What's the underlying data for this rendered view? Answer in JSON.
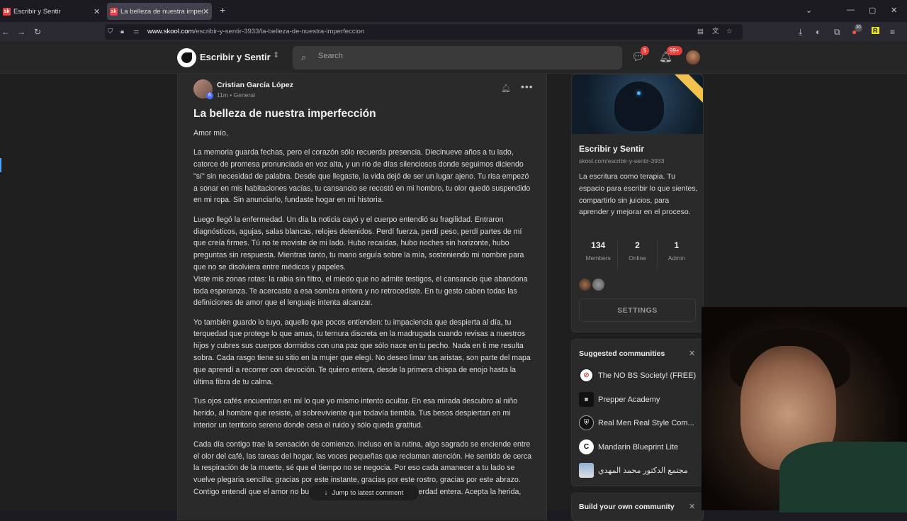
{
  "browser": {
    "tabs": [
      {
        "favicon": "sk",
        "label": "Escribir y Sentir",
        "active": false
      },
      {
        "favicon": "sk",
        "label": "La belleza de nuestra imperfecc",
        "active": true
      }
    ],
    "url_host": "www.skool.com",
    "url_path": "/escribir-y-sentir-3933/la-belleza-de-nuestra-imperfeccion",
    "ext_badge": "30"
  },
  "header": {
    "community_name": "Escribir y Sentir",
    "search_placeholder": "Search",
    "chat_badge": "5",
    "notif_badge": "99+"
  },
  "post": {
    "author": "Cristian García López",
    "level": "6",
    "time": "11m",
    "category": "General",
    "title": "La belleza de nuestra imperfección",
    "greeting": "Amor mío,",
    "p1": "La memoria guarda fechas, pero el corazón sólo recuerda presencia. Diecinueve años a tu lado, catorce de promesa pronunciada en voz alta, y un río de días silenciosos donde seguimos diciendo \"sí\" sin necesidad de palabra. Desde que llegaste, la vida dejó de ser un lugar ajeno. Tu risa empezó a sonar en mis habitaciones vacías, tu cansancio se recostó en mi hombro, tu olor quedó suspendido en mi ropa. Sin anunciarlo, fundaste hogar en mi historia.",
    "p2": "Luego llegó la enfermedad. Un día la noticia cayó y el cuerpo entendió su fragilidad. Entraron diagnósticos, agujas, salas blancas, relojes detenidos. Perdí fuerza, perdí peso, perdí partes de mí que creía firmes. Tú no te moviste de mi lado. Hubo recaídas, hubo noches sin horizonte, hubo preguntas sin respuesta. Mientras tanto, tu mano seguía sobre la mía, sosteniendo mi nombre para que no se disolviera entre médicos y papeles.",
    "p3": "Viste mis zonas rotas: la rabia sin filtro, el miedo que no admite testigos, el cansancio que abandona toda esperanza. Te acercaste a esa sombra entera y no retrocediste. En tu gesto caben todas las definiciones de amor que el lenguaje intenta alcanzar.",
    "p4": "Yo también guardo lo tuyo, aquello que pocos entienden: tu impaciencia que despierta al día, tu terquedad que protege lo que amas, tu ternura discreta en la madrugada cuando revisas a nuestros hijos y cubres sus cuerpos dormidos con una paz que sólo nace en tu pecho. Nada en ti me resulta sobra. Cada rasgo tiene su sitio en la mujer que elegí. No deseo limar tus aristas, son parte del mapa que aprendí a recorrer con devoción. Te quiero entera, desde la primera chispa de enojo hasta la última fibra de tu calma.",
    "p5": "Tus ojos cafés encuentran en mí lo que yo mismo intento ocultar. En esa mirada descubro al niño herido, al hombre que resiste, al sobreviviente que todavía tiembla. Tus besos despiertan en mi interior un territorio sereno donde cesa el ruido y sólo queda gratitud.",
    "p6": "Cada día contigo trae la sensación de comienzo. Incluso en la rutina, algo sagrado se enciende entre el olor del café, las tareas del hogar, las voces pequeñas que reclaman atención. He sentido de cerca la respiración de la muerte, sé que el tiempo no se negocia. Por eso cada amanecer a tu lado se vuelve plegaria sencilla: gracias por este instante, gracias por este rostro, gracias por este abrazo.",
    "p7": "Contigo entendí que el amor no busca pureza perfecta, prefiere la verdad entera. Acepta la herida,",
    "jump_label": "Jump to latest comment"
  },
  "sidebar": {
    "title": "Escribir y Sentir",
    "url": "skool.com/escribir-y-sentir-3933",
    "description": "La escritura como terapia. Tu espacio para escribir lo que sientes, compartirlo sin juicios, para aprender y mejorar en el proceso.",
    "stats": [
      {
        "value": "134",
        "label": "Members"
      },
      {
        "value": "2",
        "label": "Online"
      },
      {
        "value": "1",
        "label": "Admin"
      }
    ],
    "settings_label": "SETTINGS"
  },
  "suggested": {
    "title": "Suggested communities",
    "items": [
      {
        "name": "The NO BS Society! (FREE)"
      },
      {
        "name": "Prepper Academy"
      },
      {
        "name": "Real Men Real Style Com..."
      },
      {
        "name": "Mandarin Blueprint Lite"
      },
      {
        "name": "مجتمع الدكتور محمد المهدي"
      }
    ]
  },
  "build": {
    "title": "Build your own community"
  }
}
